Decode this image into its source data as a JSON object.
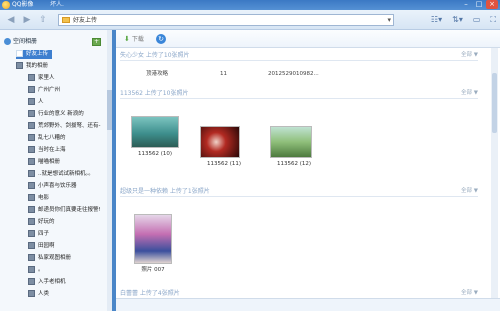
{
  "window": {
    "title": "QQ影像",
    "user": "坏人."
  },
  "address": {
    "path": "好友上传"
  },
  "toolbar": {
    "download_label": "下载"
  },
  "sidebar": {
    "root_label": "空间相册",
    "items": [
      {
        "label": "好友上传",
        "selected": true,
        "level": 0
      },
      {
        "label": "我的相册",
        "selected": false,
        "level": 0
      },
      {
        "label": "家里人",
        "level": 1
      },
      {
        "label": "广州广州",
        "level": 1
      },
      {
        "label": "人",
        "level": 1
      },
      {
        "label": "行业的意义 新浪的",
        "level": 1
      },
      {
        "label": "荒郊野外、剑拔弩、还有-",
        "level": 1
      },
      {
        "label": "乱七八糟的",
        "level": 1
      },
      {
        "label": "当时在上海",
        "level": 1
      },
      {
        "label": "喵喵相册",
        "level": 1
      },
      {
        "label": "..就是想试试新相机。。",
        "level": 1
      },
      {
        "label": "小声喜与饮乐器",
        "level": 1
      },
      {
        "label": "电影",
        "level": 1
      },
      {
        "label": "邮递员你们真要走往报警!",
        "level": 1
      },
      {
        "label": "好玩的",
        "level": 1
      },
      {
        "label": "四子",
        "level": 1
      },
      {
        "label": "田园啊",
        "level": 1
      },
      {
        "label": "私家观图相册",
        "level": 1
      },
      {
        "label": "。",
        "level": 1
      },
      {
        "label": "入手老相机",
        "level": 1
      },
      {
        "label": "人类",
        "level": 1
      }
    ]
  },
  "groups": [
    {
      "header": "失心少女 上传了10张照片",
      "more": "全部 ▼",
      "row": {
        "col1": "顶港攻略",
        "col2": "11",
        "col3": "20125290109​82..."
      }
    },
    {
      "header": "113562 上传了10张照片",
      "more": "全部 ▼",
      "photos": [
        {
          "caption": "113562 (10)",
          "color": "#3e8f8d"
        },
        {
          "caption": "113562 (11)",
          "color": "#8a1a16"
        },
        {
          "caption": "113562 (12)",
          "color": "#6e9a5a"
        }
      ]
    },
    {
      "header": "超级只是一种依赖 上传了1张照片",
      "more": "全部 ▼",
      "photos": [
        {
          "caption": "照片 007",
          "color": "#3b4f9d"
        }
      ]
    },
    {
      "header": "白蕾蕾 上传了4张照片",
      "more": "全部 ▼"
    }
  ]
}
